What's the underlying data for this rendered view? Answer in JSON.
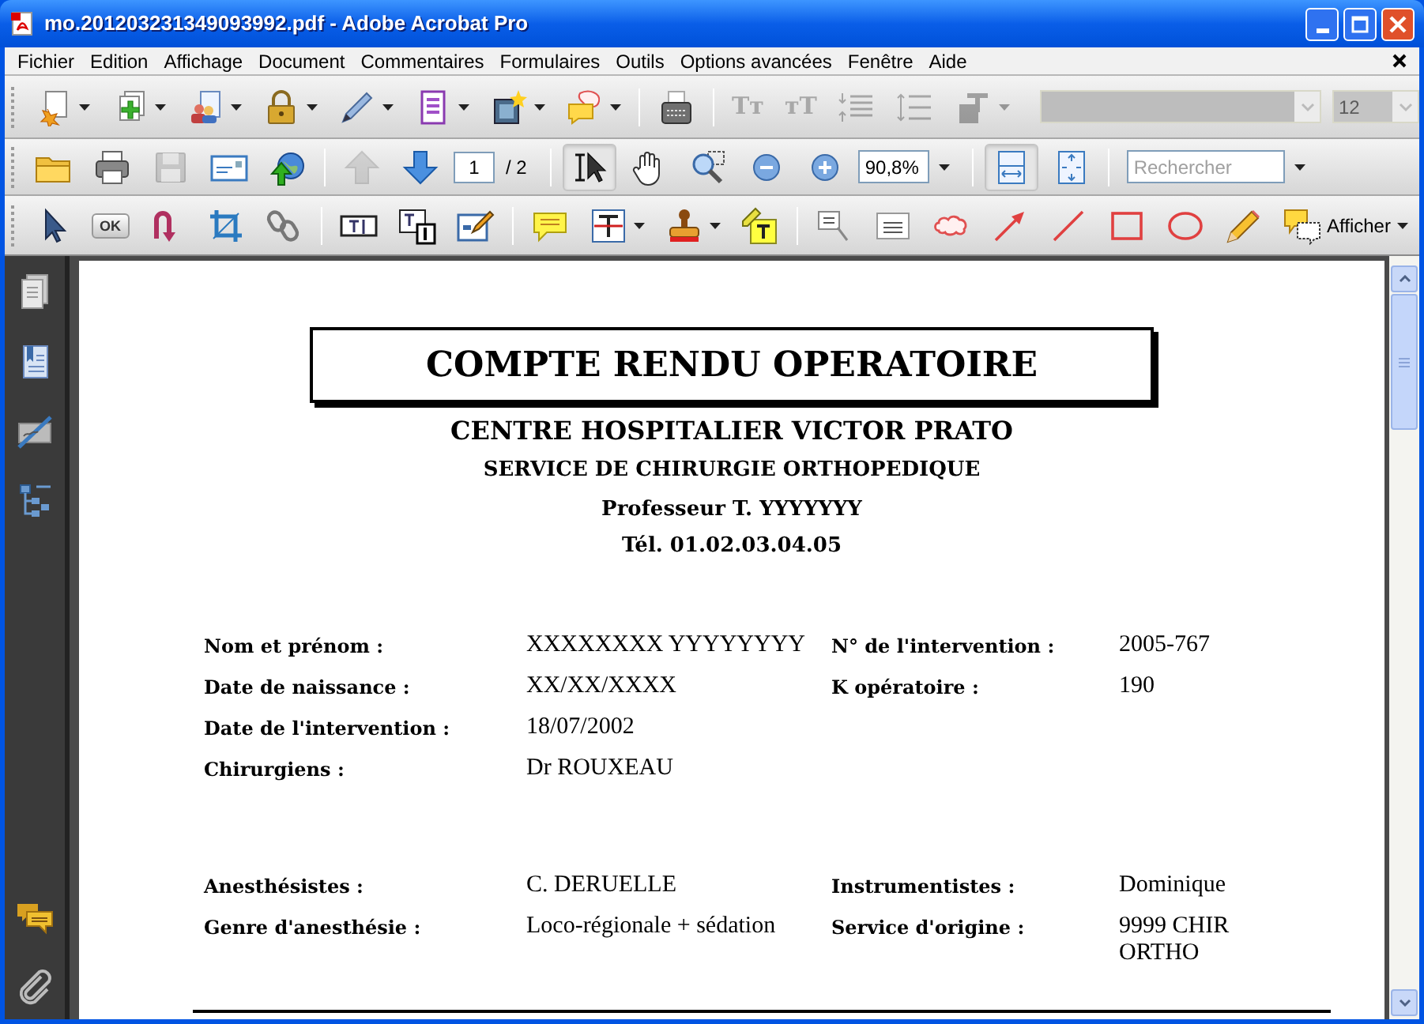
{
  "window": {
    "title": "mo.201203231349093992.pdf - Adobe Acrobat Pro"
  },
  "menu": [
    "Fichier",
    "Edition",
    "Affichage",
    "Document",
    "Commentaires",
    "Formulaires",
    "Outils",
    "Options avancées",
    "Fenêtre",
    "Aide"
  ],
  "toolbar_1": [
    {
      "kind": "create",
      "menu": true,
      "disabled": false
    },
    {
      "kind": "combine",
      "menu": true,
      "disabled": false
    },
    {
      "kind": "collaborate",
      "menu": true,
      "disabled": false
    },
    {
      "kind": "lock",
      "menu": true,
      "disabled": false
    },
    {
      "kind": "pen",
      "menu": true,
      "disabled": false
    },
    {
      "kind": "form",
      "menu": true,
      "disabled": false
    },
    {
      "kind": "film",
      "menu": true,
      "disabled": false
    },
    {
      "kind": "bubbles",
      "menu": true,
      "disabled": false
    },
    {
      "kind": "separator"
    },
    {
      "kind": "typewriter",
      "disabled": false
    },
    {
      "kind": "separator"
    },
    {
      "kind": "glyph",
      "label": "Tᴛ",
      "disabled": true
    },
    {
      "kind": "glyph",
      "label": "ᴛT",
      "disabled": true
    },
    {
      "kind": "line-spacing-down",
      "disabled": true
    },
    {
      "kind": "line-spacing-up",
      "disabled": true
    },
    {
      "kind": "text-color",
      "menu": true,
      "disabled": true
    },
    {
      "kind": "font-select",
      "disabled": true
    },
    {
      "kind": "size-select",
      "value": "12",
      "disabled": true
    }
  ],
  "toolbar_2": [
    {
      "kind": "open",
      "selected": false,
      "disabled": false
    },
    {
      "kind": "print",
      "selected": false,
      "disabled": false
    },
    {
      "kind": "save",
      "selected": false,
      "disabled": true
    },
    {
      "kind": "email",
      "selected": false,
      "disabled": false
    },
    {
      "kind": "upload",
      "selected": false,
      "disabled": false
    },
    {
      "kind": "separator"
    },
    {
      "kind": "prev-page",
      "selected": false,
      "disabled": true
    },
    {
      "kind": "next-page",
      "selected": false,
      "disabled": false
    },
    {
      "kind": "page-field",
      "value": "1",
      "total": "/ 2"
    },
    {
      "kind": "separator"
    },
    {
      "kind": "select-text",
      "selected": true,
      "disabled": false
    },
    {
      "kind": "hand",
      "selected": false,
      "disabled": false
    },
    {
      "kind": "marquee-zoom",
      "selected": false,
      "disabled": false
    },
    {
      "kind": "zoom-out",
      "selected": false,
      "disabled": false
    },
    {
      "kind": "zoom-in",
      "selected": false,
      "disabled": false
    },
    {
      "kind": "zoom-field",
      "value": "90,8%"
    },
    {
      "kind": "separator"
    },
    {
      "kind": "fit-width",
      "selected": true,
      "disabled": false
    },
    {
      "kind": "fit-page",
      "selected": false,
      "disabled": false
    },
    {
      "kind": "separator"
    },
    {
      "kind": "search-field",
      "placeholder": "Rechercher"
    }
  ],
  "toolbar_3": [
    {
      "kind": "select-object"
    },
    {
      "kind": "ok-button",
      "label": "OK"
    },
    {
      "kind": "u-arrow"
    },
    {
      "kind": "crop"
    },
    {
      "kind": "link"
    },
    {
      "kind": "separator"
    },
    {
      "kind": "text-field"
    },
    {
      "kind": "numbered-field"
    },
    {
      "kind": "edit-field"
    },
    {
      "kind": "separator"
    },
    {
      "kind": "note"
    },
    {
      "kind": "text-edit",
      "menu": true
    },
    {
      "kind": "stamp",
      "menu": true
    },
    {
      "kind": "highlight"
    },
    {
      "kind": "separator"
    },
    {
      "kind": "callout"
    },
    {
      "kind": "textbox"
    },
    {
      "kind": "cloud"
    },
    {
      "kind": "arrow"
    },
    {
      "kind": "line"
    },
    {
      "kind": "rectangle"
    },
    {
      "kind": "oval"
    },
    {
      "kind": "pencil"
    },
    {
      "kind": "show",
      "label": "Afficher",
      "menu": true
    }
  ],
  "sidebar": {
    "top": [
      {
        "kind": "pages"
      },
      {
        "kind": "bookmarks"
      },
      {
        "kind": "signatures"
      },
      {
        "kind": "tree"
      }
    ],
    "bottom": [
      {
        "kind": "comments"
      },
      {
        "kind": "attachments"
      }
    ]
  },
  "document": {
    "title": "COMPTE RENDU OPERATOIRE",
    "header": [
      "CENTRE HOSPITALIER VICTOR PRATO",
      "SERVICE DE CHIRURGIE ORTHOPEDIQUE",
      "Professeur T. YYYYYYY",
      "Tél. 01.02.03.04.05"
    ],
    "sections": [
      {
        "rows": [
          [
            {
              "label": "Nom et prénom :",
              "value": "XXXXXXXX YYYYYYYY"
            },
            {
              "label": "N° de l'intervention :",
              "value": "2005-767"
            }
          ],
          [
            {
              "label": "Date de naissance :",
              "value": "XX/XX/XXXX"
            },
            {
              "label": "K opératoire :",
              "value": "190"
            }
          ],
          [
            {
              "label": "Date de l'intervention :",
              "value": "18/07/2002"
            }
          ],
          [
            {
              "label": "Chirurgiens :",
              "value": "Dr ROUXEAU"
            }
          ]
        ]
      },
      {
        "rows": [
          [
            {
              "label": "Anesthésistes :",
              "value": "C. DERUELLE"
            },
            {
              "label": "Instrumentistes :",
              "value": "Dominique"
            }
          ],
          [
            {
              "label": "Genre d'anesthésie :",
              "value": "Loco-régionale + sédation"
            },
            {
              "label": "Service d'origine :",
              "value": "9999 CHIR ORTHO"
            }
          ]
        ]
      }
    ]
  }
}
